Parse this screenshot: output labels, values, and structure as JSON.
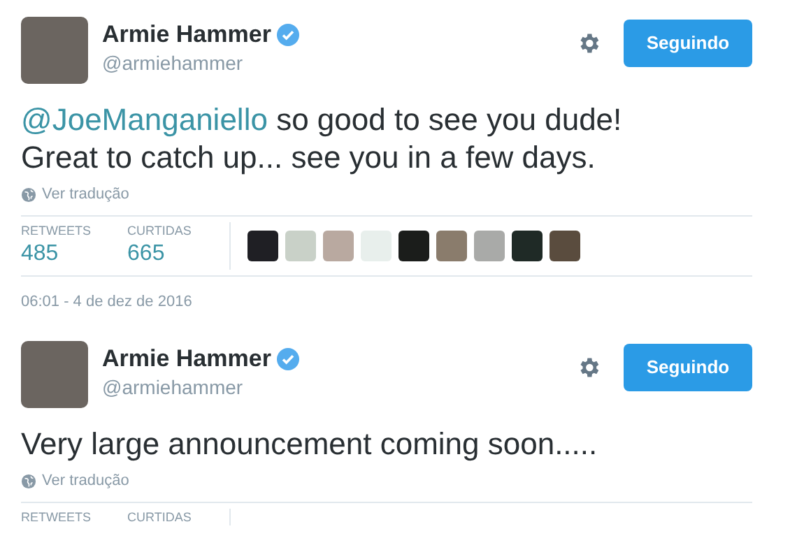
{
  "tweets": [
    {
      "name": "Armie Hammer",
      "verified": true,
      "handle": "@armiehammer",
      "follow_button": "Seguindo",
      "mention": "@JoeManganiello",
      "text": " so good to see you dude! Great to catch up... see you in a few days.",
      "translate": "Ver tradução",
      "stats": [
        {
          "label": "RETWEETS",
          "value": "485"
        },
        {
          "label": "CURTIDAS",
          "value": "665"
        }
      ],
      "timestamp": "06:01 - 4 de dez de 2016"
    },
    {
      "name": "Armie Hammer",
      "verified": true,
      "handle": "@armiehammer",
      "follow_button": "Seguindo",
      "text": "Very large announcement coming soon.....",
      "translate": "Ver tradução",
      "stats": [
        {
          "label": "RETWEETS"
        },
        {
          "label": "CURTIDAS"
        }
      ]
    }
  ]
}
